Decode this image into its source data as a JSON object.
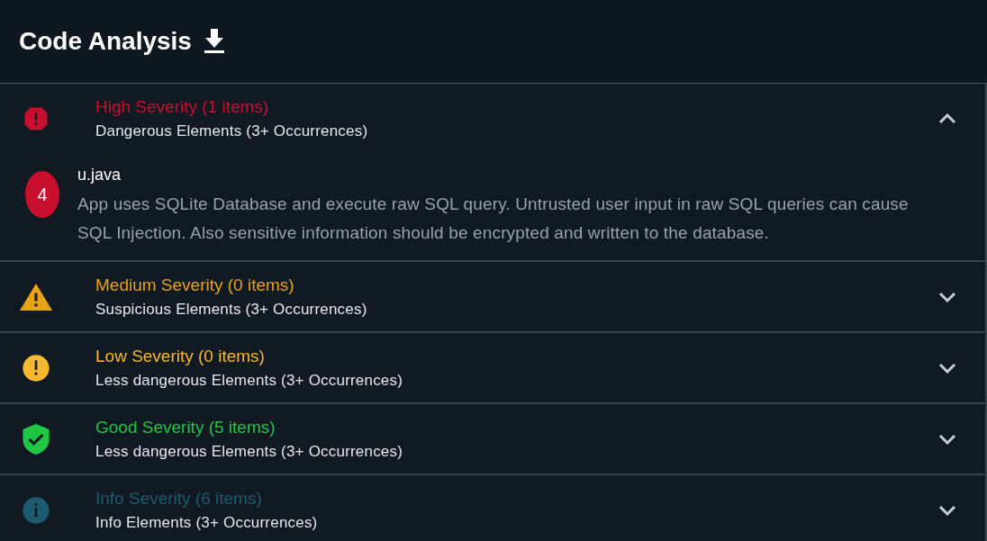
{
  "header": {
    "title": "Code Analysis"
  },
  "sections": [
    {
      "kind": "high",
      "title": "High Severity (1 items)",
      "subtitle": "Dangerous Elements (3+ Occurrences)",
      "color": "#c8102e",
      "expanded": true,
      "items": [
        {
          "count": "4",
          "file": "u.java",
          "description": "App uses SQLite Database and execute raw SQL query. Untrusted user input in raw SQL queries can cause SQL Injection. Also sensitive information should be encrypted and written to the database."
        }
      ]
    },
    {
      "kind": "medium",
      "title": "Medium Severity (0 items)",
      "subtitle": "Suspicious Elements (3+ Occurrences)",
      "color": "#e8a317",
      "expanded": false
    },
    {
      "kind": "low",
      "title": "Low Severity (0 items)",
      "subtitle": "Less dangerous Elements (3+ Occurrences)",
      "color": "#f5b82e",
      "expanded": false
    },
    {
      "kind": "good",
      "title": "Good Severity (5 items)",
      "subtitle": "Less dangerous Elements (3+ Occurrences)",
      "color": "#1fc745",
      "expanded": false
    },
    {
      "kind": "info",
      "title": "Info Severity (6 items)",
      "subtitle": "Info Elements (3+ Occurrences)",
      "color": "#1e5b6e",
      "expanded": false
    }
  ]
}
